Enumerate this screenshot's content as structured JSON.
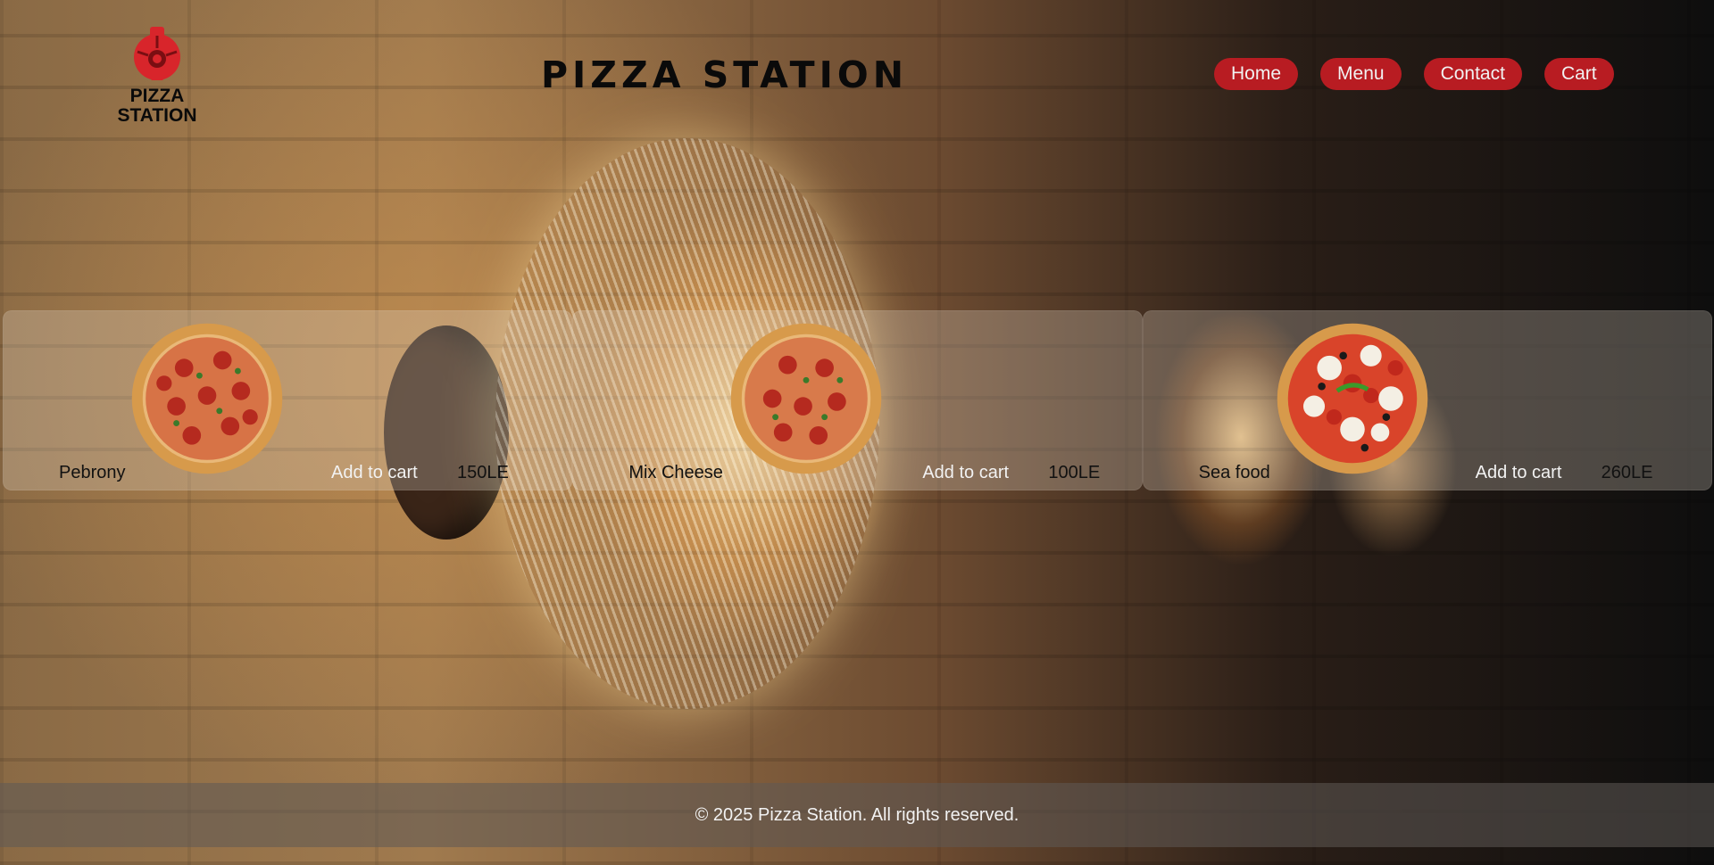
{
  "header": {
    "logo_line1": "PIZZA",
    "logo_line2": "STATION",
    "title": "PIZZA STATION"
  },
  "nav": [
    "Home",
    "Menu",
    "Contact",
    "Cart"
  ],
  "menu": [
    {
      "name": "Pebrony",
      "button": "Add to cart",
      "price": "150LE"
    },
    {
      "name": "Mix Cheese",
      "button": "Add to cart",
      "price": "100LE"
    },
    {
      "name": "Sea food",
      "button": "Add to cart",
      "price": "260LE"
    }
  ],
  "footer": {
    "text": "© 2025 Pizza Station. All rights reserved."
  },
  "colors": {
    "accent": "#b81c22",
    "pizza_crust": "#d79a4b",
    "pizza_sauce": "#c83b1e"
  }
}
